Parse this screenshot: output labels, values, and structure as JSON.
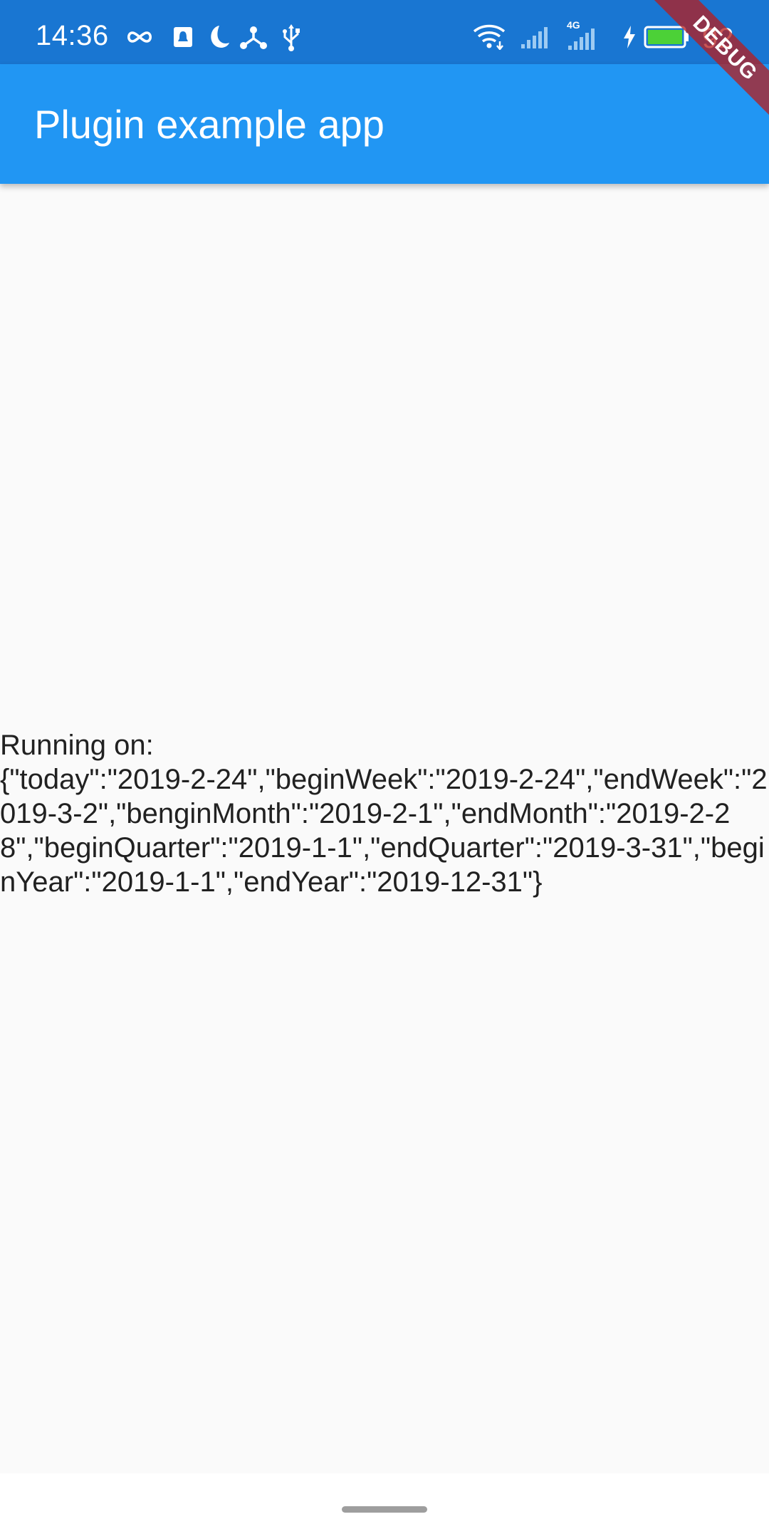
{
  "status_bar": {
    "time": "14:36",
    "battery": "92",
    "network": "4G",
    "icons": [
      "infinity-icon",
      "notification-icon",
      "moon-icon",
      "share-icon",
      "usb-icon",
      "wifi-icon",
      "signal-icon",
      "signal-4g-icon",
      "charging-icon",
      "battery-icon"
    ],
    "background_color": "#1976d2"
  },
  "app_bar": {
    "title": "Plugin example app",
    "background_color": "#2196f3"
  },
  "main": {
    "label": "Running on:",
    "result": "{\"today\":\"2019-2-24\",\"beginWeek\":\"2019-2-24\",\"endWeek\":\"2019-3-2\",\"benginMonth\":\"2019-2-1\",\"endMonth\":\"2019-2-28\",\"beginQuarter\":\"2019-1-1\",\"endQuarter\":\"2019-3-31\",\"beginYear\":\"2019-1-1\",\"endYear\":\"2019-12-31\"}"
  },
  "debug_banner": {
    "label": "DEBUG",
    "color": "#b71c1c"
  }
}
